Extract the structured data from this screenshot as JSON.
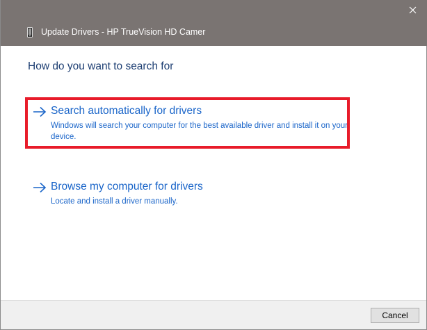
{
  "window": {
    "title": "Update Drivers - HP TrueVision HD Camer",
    "close_icon": "close-icon",
    "device_icon": "camera-device-icon"
  },
  "main": {
    "heading": "How do you want to search for",
    "options": [
      {
        "title": "Search automatically for drivers",
        "description": "Windows will search your computer for the best available driver and install it on your device.",
        "icon": "arrow-right-icon",
        "highlighted": true
      },
      {
        "title": "Browse my computer for drivers",
        "description": "Locate and install a driver manually.",
        "icon": "arrow-right-icon",
        "highlighted": false
      }
    ]
  },
  "footer": {
    "cancel_label": "Cancel"
  },
  "colors": {
    "titlebar": "#7a7472",
    "link": "#1a65c9",
    "heading": "#1e3f73",
    "highlight": "#e81c2a"
  }
}
